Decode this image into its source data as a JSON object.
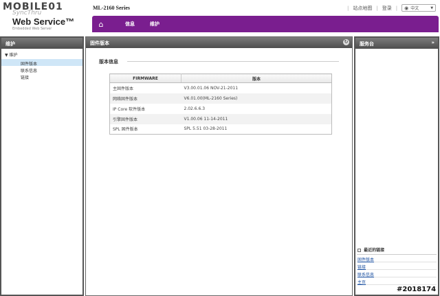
{
  "header": {
    "brand_logo": "MOBILE01",
    "logo_sub": "SyncThru",
    "logo_title": "Web Service™",
    "logo_tagline": "Embedded Web Server",
    "model": "ML-2160 Series",
    "sitemap": "站点地图",
    "login": "登录",
    "language": "中文"
  },
  "nav": {
    "items": [
      "信息",
      "维护"
    ]
  },
  "left_panel": {
    "title": "维护",
    "tree_root": "维护",
    "items": [
      "固件版本",
      "联系信息",
      "链接"
    ],
    "active_index": 0
  },
  "center_panel": {
    "title": "固件版本",
    "section_title": "版本信息",
    "table": {
      "headers": [
        "FIRMWARE",
        "版本"
      ],
      "rows": [
        [
          "主固件版本",
          "V3.00.01.06 NOV-21-2011"
        ],
        [
          "网络固件版本",
          "V6.01.00(ML-2160 Series)"
        ],
        [
          "IP Core 软件版本",
          "2.02.6.6.3"
        ],
        [
          "引擎固件版本",
          "V1.00.06 11-14-2011"
        ],
        [
          "SPL 固件版本",
          "SPL 5.51 03-28-2011"
        ]
      ]
    }
  },
  "right_panel": {
    "title": "服务台",
    "recent_title": "最近的链接",
    "recent_links": [
      "固件版本",
      "链接",
      "联系信息",
      "主页"
    ]
  },
  "watermark": "#2018174"
}
